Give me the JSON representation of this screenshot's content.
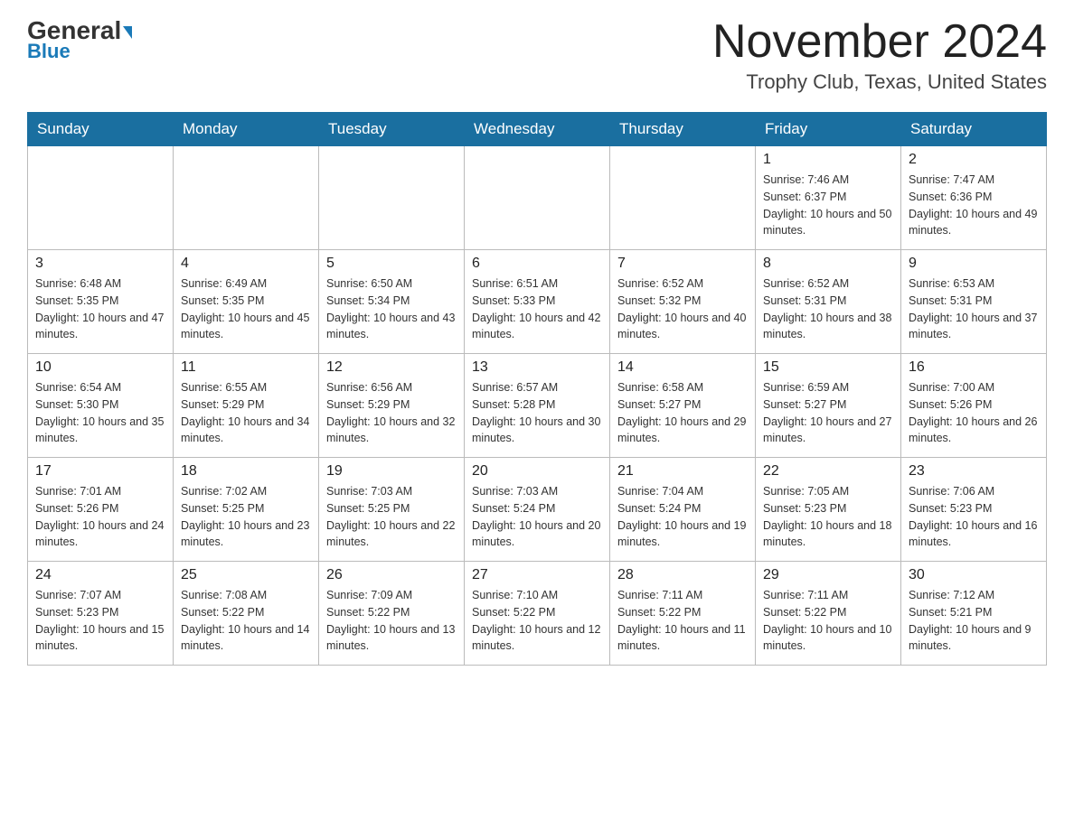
{
  "header": {
    "logo_general": "General",
    "logo_blue": "Blue",
    "month_title": "November 2024",
    "location": "Trophy Club, Texas, United States"
  },
  "calendar": {
    "days_of_week": [
      "Sunday",
      "Monday",
      "Tuesday",
      "Wednesday",
      "Thursday",
      "Friday",
      "Saturday"
    ],
    "weeks": [
      {
        "days": [
          {
            "number": "",
            "sunrise": "",
            "sunset": "",
            "daylight": ""
          },
          {
            "number": "",
            "sunrise": "",
            "sunset": "",
            "daylight": ""
          },
          {
            "number": "",
            "sunrise": "",
            "sunset": "",
            "daylight": ""
          },
          {
            "number": "",
            "sunrise": "",
            "sunset": "",
            "daylight": ""
          },
          {
            "number": "",
            "sunrise": "",
            "sunset": "",
            "daylight": ""
          },
          {
            "number": "1",
            "sunrise": "Sunrise: 7:46 AM",
            "sunset": "Sunset: 6:37 PM",
            "daylight": "Daylight: 10 hours and 50 minutes."
          },
          {
            "number": "2",
            "sunrise": "Sunrise: 7:47 AM",
            "sunset": "Sunset: 6:36 PM",
            "daylight": "Daylight: 10 hours and 49 minutes."
          }
        ]
      },
      {
        "days": [
          {
            "number": "3",
            "sunrise": "Sunrise: 6:48 AM",
            "sunset": "Sunset: 5:35 PM",
            "daylight": "Daylight: 10 hours and 47 minutes."
          },
          {
            "number": "4",
            "sunrise": "Sunrise: 6:49 AM",
            "sunset": "Sunset: 5:35 PM",
            "daylight": "Daylight: 10 hours and 45 minutes."
          },
          {
            "number": "5",
            "sunrise": "Sunrise: 6:50 AM",
            "sunset": "Sunset: 5:34 PM",
            "daylight": "Daylight: 10 hours and 43 minutes."
          },
          {
            "number": "6",
            "sunrise": "Sunrise: 6:51 AM",
            "sunset": "Sunset: 5:33 PM",
            "daylight": "Daylight: 10 hours and 42 minutes."
          },
          {
            "number": "7",
            "sunrise": "Sunrise: 6:52 AM",
            "sunset": "Sunset: 5:32 PM",
            "daylight": "Daylight: 10 hours and 40 minutes."
          },
          {
            "number": "8",
            "sunrise": "Sunrise: 6:52 AM",
            "sunset": "Sunset: 5:31 PM",
            "daylight": "Daylight: 10 hours and 38 minutes."
          },
          {
            "number": "9",
            "sunrise": "Sunrise: 6:53 AM",
            "sunset": "Sunset: 5:31 PM",
            "daylight": "Daylight: 10 hours and 37 minutes."
          }
        ]
      },
      {
        "days": [
          {
            "number": "10",
            "sunrise": "Sunrise: 6:54 AM",
            "sunset": "Sunset: 5:30 PM",
            "daylight": "Daylight: 10 hours and 35 minutes."
          },
          {
            "number": "11",
            "sunrise": "Sunrise: 6:55 AM",
            "sunset": "Sunset: 5:29 PM",
            "daylight": "Daylight: 10 hours and 34 minutes."
          },
          {
            "number": "12",
            "sunrise": "Sunrise: 6:56 AM",
            "sunset": "Sunset: 5:29 PM",
            "daylight": "Daylight: 10 hours and 32 minutes."
          },
          {
            "number": "13",
            "sunrise": "Sunrise: 6:57 AM",
            "sunset": "Sunset: 5:28 PM",
            "daylight": "Daylight: 10 hours and 30 minutes."
          },
          {
            "number": "14",
            "sunrise": "Sunrise: 6:58 AM",
            "sunset": "Sunset: 5:27 PM",
            "daylight": "Daylight: 10 hours and 29 minutes."
          },
          {
            "number": "15",
            "sunrise": "Sunrise: 6:59 AM",
            "sunset": "Sunset: 5:27 PM",
            "daylight": "Daylight: 10 hours and 27 minutes."
          },
          {
            "number": "16",
            "sunrise": "Sunrise: 7:00 AM",
            "sunset": "Sunset: 5:26 PM",
            "daylight": "Daylight: 10 hours and 26 minutes."
          }
        ]
      },
      {
        "days": [
          {
            "number": "17",
            "sunrise": "Sunrise: 7:01 AM",
            "sunset": "Sunset: 5:26 PM",
            "daylight": "Daylight: 10 hours and 24 minutes."
          },
          {
            "number": "18",
            "sunrise": "Sunrise: 7:02 AM",
            "sunset": "Sunset: 5:25 PM",
            "daylight": "Daylight: 10 hours and 23 minutes."
          },
          {
            "number": "19",
            "sunrise": "Sunrise: 7:03 AM",
            "sunset": "Sunset: 5:25 PM",
            "daylight": "Daylight: 10 hours and 22 minutes."
          },
          {
            "number": "20",
            "sunrise": "Sunrise: 7:03 AM",
            "sunset": "Sunset: 5:24 PM",
            "daylight": "Daylight: 10 hours and 20 minutes."
          },
          {
            "number": "21",
            "sunrise": "Sunrise: 7:04 AM",
            "sunset": "Sunset: 5:24 PM",
            "daylight": "Daylight: 10 hours and 19 minutes."
          },
          {
            "number": "22",
            "sunrise": "Sunrise: 7:05 AM",
            "sunset": "Sunset: 5:23 PM",
            "daylight": "Daylight: 10 hours and 18 minutes."
          },
          {
            "number": "23",
            "sunrise": "Sunrise: 7:06 AM",
            "sunset": "Sunset: 5:23 PM",
            "daylight": "Daylight: 10 hours and 16 minutes."
          }
        ]
      },
      {
        "days": [
          {
            "number": "24",
            "sunrise": "Sunrise: 7:07 AM",
            "sunset": "Sunset: 5:23 PM",
            "daylight": "Daylight: 10 hours and 15 minutes."
          },
          {
            "number": "25",
            "sunrise": "Sunrise: 7:08 AM",
            "sunset": "Sunset: 5:22 PM",
            "daylight": "Daylight: 10 hours and 14 minutes."
          },
          {
            "number": "26",
            "sunrise": "Sunrise: 7:09 AM",
            "sunset": "Sunset: 5:22 PM",
            "daylight": "Daylight: 10 hours and 13 minutes."
          },
          {
            "number": "27",
            "sunrise": "Sunrise: 7:10 AM",
            "sunset": "Sunset: 5:22 PM",
            "daylight": "Daylight: 10 hours and 12 minutes."
          },
          {
            "number": "28",
            "sunrise": "Sunrise: 7:11 AM",
            "sunset": "Sunset: 5:22 PM",
            "daylight": "Daylight: 10 hours and 11 minutes."
          },
          {
            "number": "29",
            "sunrise": "Sunrise: 7:11 AM",
            "sunset": "Sunset: 5:22 PM",
            "daylight": "Daylight: 10 hours and 10 minutes."
          },
          {
            "number": "30",
            "sunrise": "Sunrise: 7:12 AM",
            "sunset": "Sunset: 5:21 PM",
            "daylight": "Daylight: 10 hours and 9 minutes."
          }
        ]
      }
    ]
  }
}
